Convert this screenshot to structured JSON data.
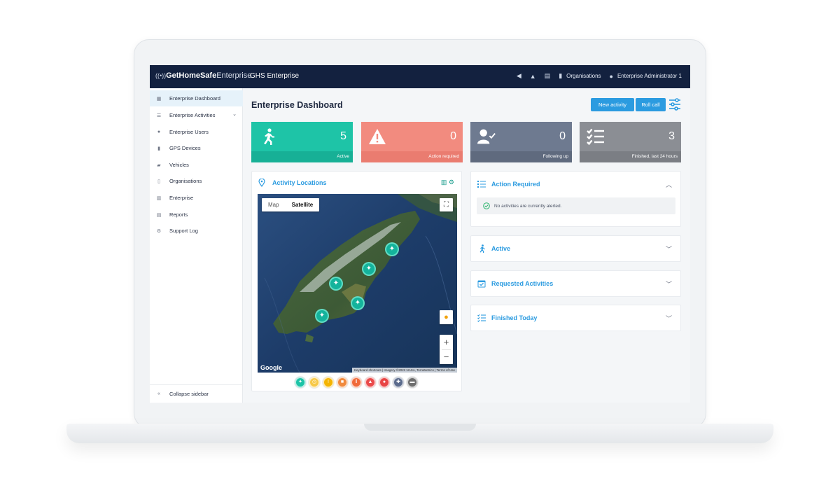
{
  "topbar": {
    "brand_bold": "GetHomeSafe",
    "brand_light": "Enterprise",
    "app_title": "GHS Enterprise",
    "organisations_label": "Organisations",
    "user_label": "Enterprise Administrator 1"
  },
  "sidebar": {
    "items": [
      {
        "label": "Enterprise Dashboard",
        "icon": "dashboard-icon",
        "active": true
      },
      {
        "label": "Enterprise Activities",
        "icon": "list-icon",
        "expandable": true
      },
      {
        "label": "Enterprise Users",
        "icon": "user-icon"
      },
      {
        "label": "GPS Devices",
        "icon": "device-icon"
      },
      {
        "label": "Vehicles",
        "icon": "vehicle-icon"
      },
      {
        "label": "Organisations",
        "icon": "building-icon"
      },
      {
        "label": "Enterprise",
        "icon": "enterprise-icon"
      },
      {
        "label": "Reports",
        "icon": "report-icon"
      },
      {
        "label": "Support Log",
        "icon": "support-icon"
      }
    ],
    "collapse_label": "Collapse sidebar"
  },
  "main": {
    "title": "Enterprise Dashboard",
    "new_activity_label": "New activity",
    "roll_call_label": "Roll call"
  },
  "cards": [
    {
      "value": "5",
      "label": "Active",
      "color": "#1ec4a7",
      "footer_color": "#17b096",
      "icon": "walker-icon"
    },
    {
      "value": "0",
      "label": "Action required",
      "color": "#f28b7f",
      "footer_color": "#ea7c70",
      "icon": "warning-icon"
    },
    {
      "value": "0",
      "label": "Following up",
      "color": "#6e7a90",
      "footer_color": "#5f6a7e",
      "icon": "user-check-icon"
    },
    {
      "value": "3",
      "label": "Finished, last 24 hours",
      "color": "#8b8e94",
      "footer_color": "#7b7e84",
      "icon": "checklist-icon"
    }
  ],
  "map_panel": {
    "title": "Activity Locations",
    "toggle_map": "Map",
    "toggle_satellite": "Satellite",
    "google": "Google",
    "attribution": "Keyboard shortcuts | Imagery ©2022 NASA, TerraMetrics | Terms of Use",
    "legend": [
      {
        "color": "#1ec4a7",
        "icon": "walker-icon"
      },
      {
        "color": "#f7c948",
        "icon": "clock-icon"
      },
      {
        "color": "#f4b400",
        "icon": "alert-icon"
      },
      {
        "color": "#f08a3e",
        "icon": "stop-icon"
      },
      {
        "color": "#f06a3a",
        "icon": "pause-icon"
      },
      {
        "color": "#ea4b4b",
        "icon": "warning-icon"
      },
      {
        "color": "#e84545",
        "icon": "sos-icon"
      },
      {
        "color": "#5b6b8c",
        "icon": "plus-icon"
      },
      {
        "color": "#6e6e6e",
        "icon": "car-icon"
      }
    ]
  },
  "action_required": {
    "title": "Action Required",
    "message": "No activities are currently alerted."
  },
  "accordions": [
    {
      "title": "Active",
      "icon": "walker-icon"
    },
    {
      "title": "Requested Activities",
      "icon": "calendar-icon"
    },
    {
      "title": "Finished Today",
      "icon": "checklist-icon"
    }
  ]
}
